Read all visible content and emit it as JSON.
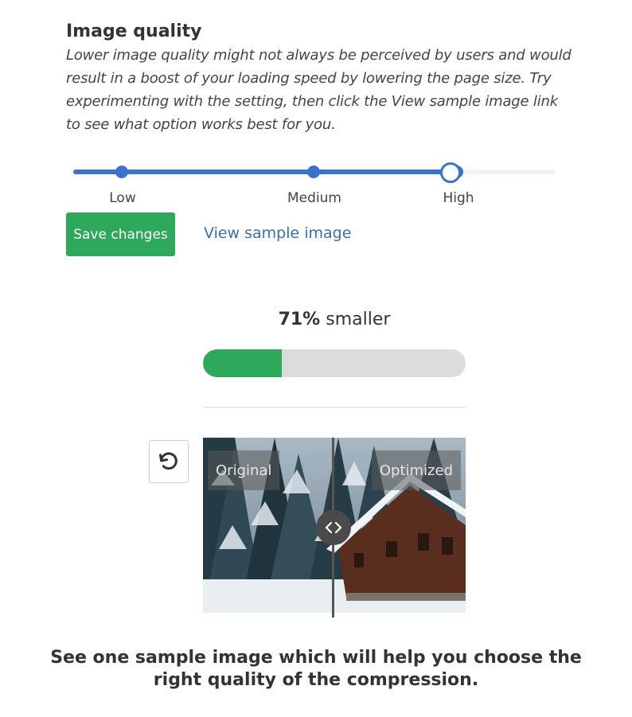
{
  "section": {
    "title": "Image quality",
    "description": "Lower image quality might not always be perceived by users and would result in a boost of your loading speed by lowering the page size. Try experimenting with the setting, then click the View sample image link to see what option works best for you."
  },
  "quality_slider": {
    "options": [
      "Low",
      "Medium",
      "High"
    ],
    "selected": "High",
    "selected_fraction": 0.8
  },
  "actions": {
    "save_label": "Save changes",
    "sample_link_label": "View sample image"
  },
  "compression": {
    "percent": "71%",
    "suffix": "smaller",
    "progress_fraction": 0.3
  },
  "comparison": {
    "left_label": "Original",
    "right_label": "Optimized",
    "split_fraction": 0.5
  },
  "footer": {
    "text": "See one sample image which will help you choose the right quality of the compression."
  },
  "colors": {
    "accent": "#3a73cc",
    "success": "#2ea85a",
    "link": "#3a6fb0"
  },
  "icons": {
    "reset": "rotate-ccw-icon",
    "compare_handle": "code-arrows-icon"
  }
}
